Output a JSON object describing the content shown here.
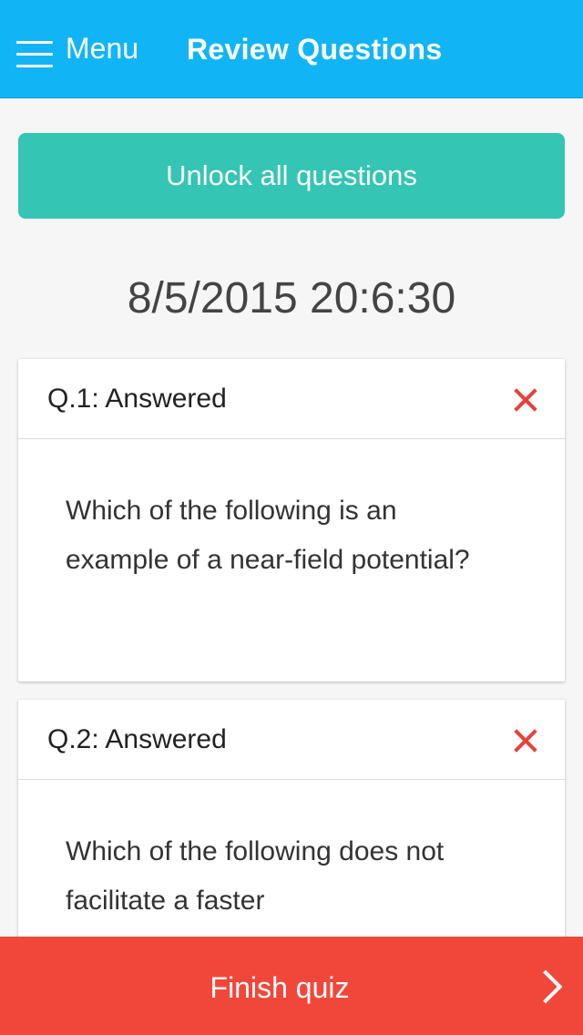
{
  "colors": {
    "primary": "#11b5f6",
    "teal": "#34c5b4",
    "danger": "#f1473a",
    "wrong": "#e8403a"
  },
  "header": {
    "menu_label": "Menu",
    "title": "Review Questions",
    "menu_icon": "hamburger-icon"
  },
  "unlock_button": {
    "label": "Unlock all questions"
  },
  "timestamp": "8/5/2015 20:6:30",
  "questions": [
    {
      "title": "Q.1: Answered",
      "status_icon": "close-icon",
      "text": "Which of the following is an example of a near-field potential?"
    },
    {
      "title": "Q.2: Answered",
      "status_icon": "close-icon",
      "text": "Which of the following does not facilitate a faster"
    }
  ],
  "footer": {
    "finish_label": "Finish quiz",
    "next_icon": "chevron-right-icon"
  }
}
